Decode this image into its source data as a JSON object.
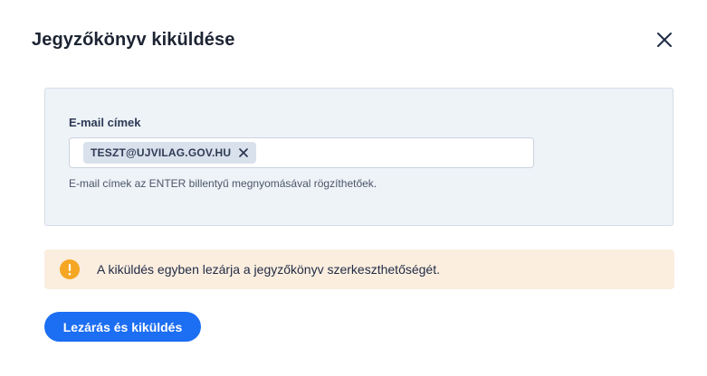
{
  "dialog": {
    "title": "Jegyzőkönyv kiküldése"
  },
  "email": {
    "label": "E-mail címek",
    "chips": [
      "TESZT@UJVILAG.GOV.HU"
    ],
    "hint": "E-mail címek az ENTER billentyű megnyomásával rögzíthetőek."
  },
  "alert": {
    "text": "A kiküldés egyben lezárja a jegyzőkönyv szerkeszthetőségét.",
    "color": "#f5a623"
  },
  "actions": {
    "submit_label": "Lezárás és kiküldés",
    "accent": "#1c6ef2"
  },
  "icons": {
    "close": "close-icon",
    "chip_remove": "chip-remove-icon",
    "alert": "warning-icon"
  }
}
